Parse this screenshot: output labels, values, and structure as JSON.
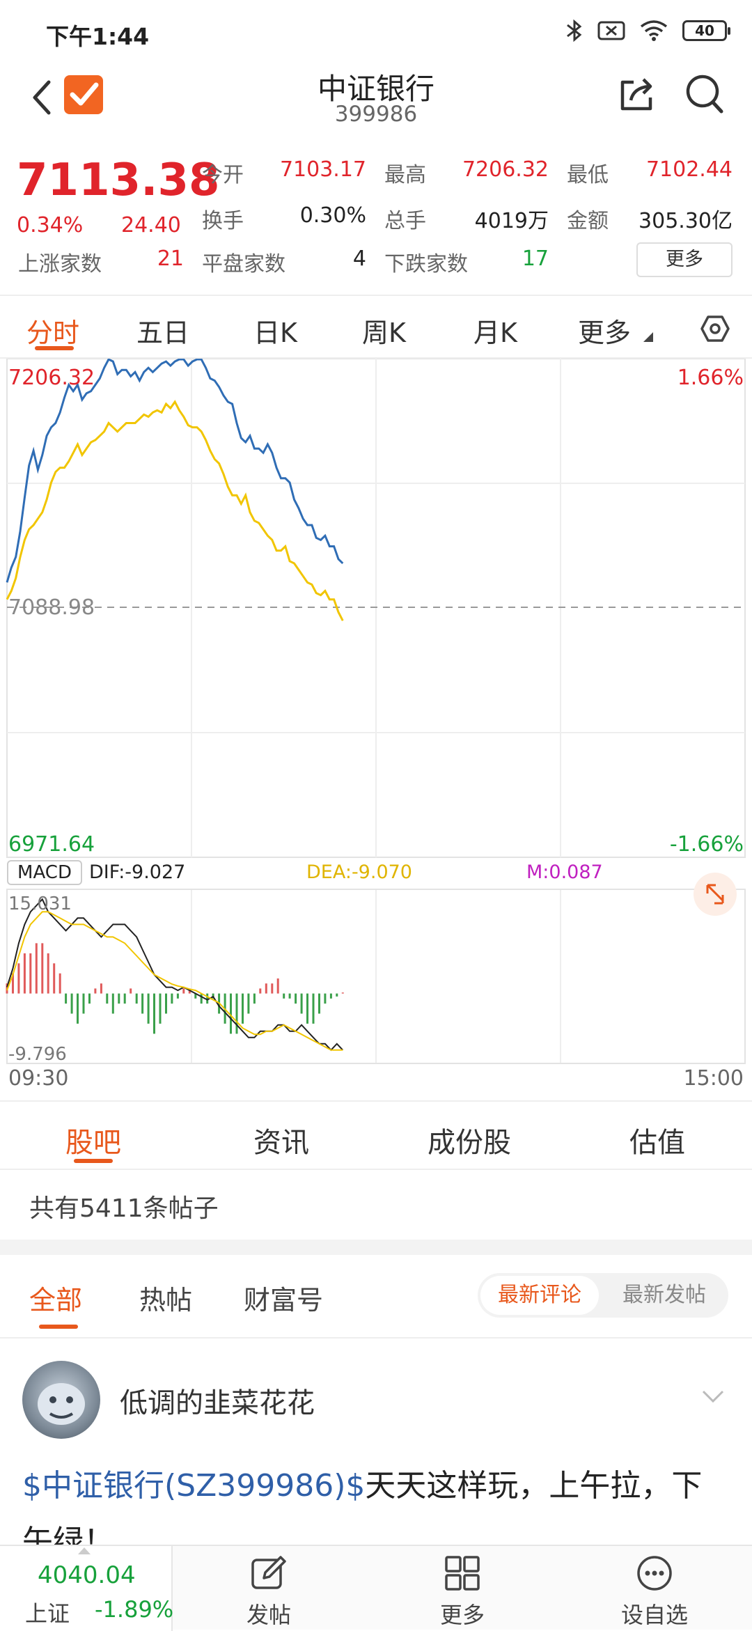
{
  "status_bar": {
    "time": "下午1:44",
    "battery": "40"
  },
  "header": {
    "name": "中证银行",
    "code": "399986"
  },
  "quote": {
    "price": "7113.38",
    "change_pct": "0.34%",
    "change": "24.40",
    "open_label": "今开",
    "open": "7103.17",
    "high_label": "最高",
    "high": "7206.32",
    "low_label": "最低",
    "low": "7102.44",
    "turnover_label": "换手",
    "turnover": "0.30%",
    "volume_label": "总手",
    "volume": "4019万",
    "amount_label": "金额",
    "amount": "305.30亿",
    "up_label": "上涨家数",
    "up": "21",
    "flat_label": "平盘家数",
    "flat": "4",
    "down_label": "下跌家数",
    "down": "17",
    "more_btn": "更多"
  },
  "chart_tabs": [
    "分时",
    "五日",
    "日K",
    "周K",
    "月K",
    "更多"
  ],
  "chart_data": {
    "type": "line",
    "price_chart": {
      "y_top_label": "7206.32",
      "y_mid_label": "7088.98",
      "y_bottom_label": "6971.64",
      "pct_top_label": "1.66%",
      "pct_bottom_label": "-1.66%",
      "ylim": [
        6971.64,
        7206.32
      ],
      "series": [
        {
          "color": "#2f6db5",
          "values": [
            7101,
            7108,
            7113,
            7125,
            7141,
            7156,
            7163,
            7154,
            7161,
            7170,
            7174,
            7176,
            7181,
            7188,
            7194,
            7191,
            7194,
            7187,
            7190,
            7191,
            7194,
            7197,
            7202,
            7206,
            7205,
            7199,
            7201,
            7201,
            7198,
            7200,
            7196,
            7200,
            7202,
            7200,
            7202,
            7204,
            7205,
            7203,
            7205,
            7206,
            7206,
            7203,
            7205,
            7206,
            7206,
            7202,
            7197,
            7196,
            7193,
            7189,
            7186,
            7185,
            7176,
            7169,
            7167,
            7170,
            7164,
            7164,
            7162,
            7166,
            7162,
            7155,
            7150,
            7150,
            7148,
            7140,
            7136,
            7131,
            7128,
            7128,
            7122,
            7121,
            7123,
            7118,
            7118,
            7112,
            7110
          ]
        },
        {
          "color": "#f1c500",
          "values": [
            7093,
            7097,
            7103,
            7113,
            7121,
            7126,
            7128,
            7131,
            7134,
            7140,
            7148,
            7153,
            7155,
            7155,
            7158,
            7162,
            7166,
            7161,
            7164,
            7167,
            7168,
            7170,
            7172,
            7176,
            7174,
            7172,
            7174,
            7176,
            7176,
            7176,
            7178,
            7180,
            7179,
            7181,
            7182,
            7181,
            7185,
            7183,
            7186,
            7182,
            7179,
            7175,
            7174,
            7174,
            7172,
            7168,
            7163,
            7159,
            7157,
            7152,
            7146,
            7142,
            7142,
            7138,
            7142,
            7134,
            7130,
            7129,
            7126,
            7123,
            7121,
            7116,
            7116,
            7118,
            7111,
            7110,
            7107,
            7104,
            7101,
            7100,
            7096,
            7095,
            7097,
            7093,
            7093,
            7087,
            7083
          ]
        }
      ]
    },
    "macd": {
      "label": "MACD",
      "dif_label": "DIF:-9.027",
      "dea_label": "DEA:-9.070",
      "m_label": "M:0.087",
      "y_top_label": "15.031",
      "y_bottom_label": "-9.796",
      "ylim": [
        -9.796,
        15.031
      ],
      "dif": [
        1,
        4,
        8,
        11,
        13,
        14,
        15,
        13,
        12,
        11,
        10,
        11,
        12,
        12,
        11,
        10,
        9,
        10,
        11,
        11,
        11,
        10,
        9,
        7,
        5,
        3,
        2,
        1,
        1,
        0.5,
        1,
        0.5,
        0,
        -0.5,
        -1,
        -0.5,
        -2,
        -3,
        -4,
        -5,
        -6,
        -7,
        -7,
        -6,
        -6,
        -6,
        -5,
        -5,
        -6,
        -6,
        -5,
        -6,
        -7,
        -8,
        -8,
        -9,
        -8,
        -9
      ],
      "dea": [
        0.5,
        3,
        6,
        9,
        11,
        12,
        13,
        13,
        12.5,
        12,
        11.5,
        11,
        11,
        11,
        10.5,
        10,
        9.5,
        9,
        9,
        8.5,
        8,
        7,
        6,
        5,
        4,
        3,
        2.5,
        2,
        1.5,
        1.2,
        1,
        0.7,
        0.5,
        0,
        -0.5,
        -1,
        -1.5,
        -2.5,
        -3.5,
        -4.5,
        -5.5,
        -6,
        -6.5,
        -6.5,
        -6,
        -6,
        -5.5,
        -5,
        -5.5,
        -6,
        -6.5,
        -7,
        -7.5,
        -8,
        -8.5,
        -9,
        -9,
        -9
      ],
      "hist": [
        1,
        2,
        3,
        4,
        4,
        5,
        5,
        4,
        3,
        2,
        -1,
        -2,
        -3,
        -2,
        -1,
        0.5,
        1,
        -1,
        -2,
        -1,
        -1,
        0.5,
        -1,
        -2,
        -3,
        -4,
        -3,
        -2,
        -1,
        -0.5,
        0.5,
        0.5,
        -0.5,
        -1,
        -1,
        -0.5,
        -2,
        -3,
        -4,
        -4,
        -3,
        -2,
        -1,
        0.5,
        1,
        1,
        1.5,
        -0.5,
        -0.5,
        -1,
        -2,
        -3,
        -3,
        -2,
        -1,
        -0.5,
        -0.3,
        0.1
      ]
    },
    "x_start_label": "09:30",
    "x_end_label": "15:00"
  },
  "stock_tabs": [
    "股吧",
    "资讯",
    "成份股",
    "估值"
  ],
  "posts_count": "共有5411条帖子",
  "filter_tabs": [
    "全部",
    "热帖",
    "财富号"
  ],
  "sort_options": [
    "最新评论",
    "最新发帖"
  ],
  "post": {
    "author": "低调的韭菜花花",
    "stock_tag": "$中证银行(SZ399986)$",
    "text": "天天这样玩，上午拉，下午绿！"
  },
  "bottom_bar": {
    "index_value": "4040.04",
    "index_name": "上证",
    "index_change": "-1.89%",
    "post_btn": "发帖",
    "more_btn": "更多",
    "watch_btn": "设自选"
  }
}
